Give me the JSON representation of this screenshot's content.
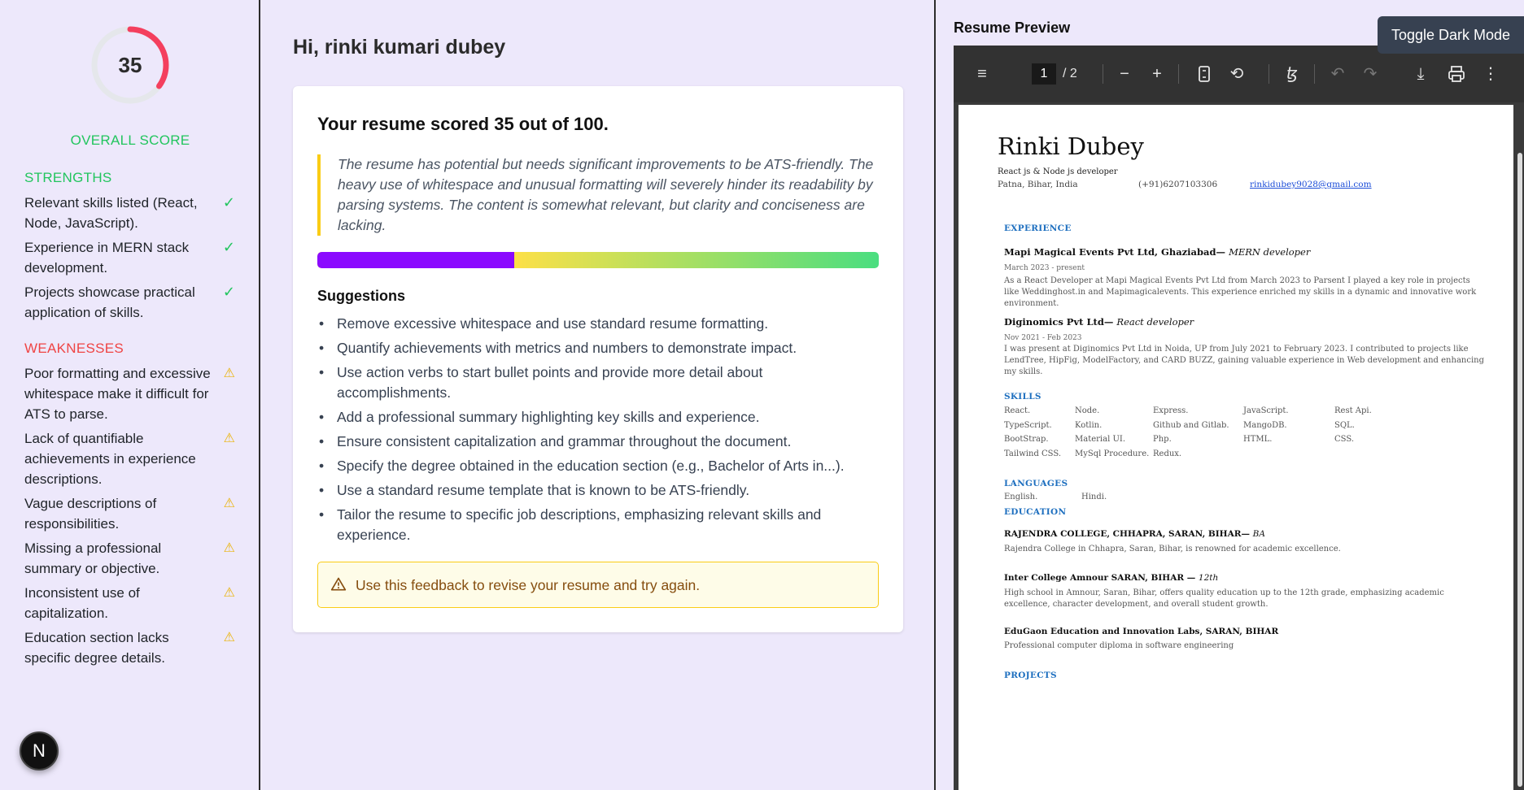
{
  "sidebar": {
    "score": "35",
    "score_fraction": 0.35,
    "overall_label": "OVERALL SCORE",
    "strengths_title": "STRENGTHS",
    "strengths": [
      "Relevant skills listed (React, Node, JavaScript).",
      "Experience in MERN stack development.",
      "Projects showcase practical application of skills."
    ],
    "weaknesses_title": "WEAKNESSES",
    "weaknesses": [
      "Poor formatting and excessive whitespace make it difficult for ATS to parse.",
      "Lack of quantifiable achievements in experience descriptions.",
      "Vague descriptions of responsibilities.",
      "Missing a professional summary or objective.",
      "Inconsistent use of capitalization.",
      "Education section lacks specific degree details."
    ],
    "check_glyph": "✓",
    "warn_glyph": "⚠",
    "fab_label": "N"
  },
  "main": {
    "greeting": "Hi, rinki kumari dubey",
    "headline": "Your resume scored 35 out of 100.",
    "summary": "The resume has potential but needs significant improvements to be ATS-friendly. The heavy use of whitespace and unusual formatting will severely hinder its readability by parsing systems. The content is somewhat relevant, but clarity and conciseness are lacking.",
    "score_bar_fraction": 0.35,
    "suggestions_title": "Suggestions",
    "suggestions": [
      "Remove excessive whitespace and use standard resume formatting.",
      "Quantify achievements with metrics and numbers to demonstrate impact.",
      "Use action verbs to start bullet points and provide more detail about accomplishments.",
      "Add a professional summary highlighting key skills and experience.",
      "Ensure consistent capitalization and grammar throughout the document.",
      "Specify the degree obtained in the education section (e.g., Bachelor of Arts in...).",
      "Use a standard resume template that is known to be ATS-friendly.",
      "Tailor the resume to specific job descriptions, emphasizing relevant skills and experience."
    ],
    "alert": "Use this feedback to revise your resume and try again."
  },
  "preview": {
    "title": "Resume Preview",
    "toggle_label": "Toggle Dark Mode",
    "toolbar": {
      "page_current": "1",
      "page_total": "/ 2",
      "icons": [
        "menu-icon",
        "zoom-out-icon",
        "zoom-in-icon",
        "fit-page-icon",
        "rotate-icon",
        "annotate-icon",
        "undo-icon",
        "redo-icon",
        "download-icon",
        "print-icon",
        "more-icon"
      ]
    },
    "resume": {
      "name": "Rinki Dubey",
      "subtitle": "React js & Node js developer",
      "location": "Patna, Bihar, India",
      "phone": "(+91)6207103306",
      "email": "rinkidubey9028@gmail.com",
      "experience_title": "EXPERIENCE",
      "job1_company": "Mapi Magical Events Pvt Ltd, Ghaziabad—",
      "job1_role": "MERN developer",
      "job1_date": "March 2023 - present",
      "job1_desc": "As a React Developer at Mapi Magical Events Pvt Ltd from March 2023 to Parsent I played a key role in projects like Weddinghost.in and Mapimagicalevents. This experience enriched my skills in a dynamic and innovative work environment.",
      "job2_company": "Diginomics Pvt Ltd—",
      "job2_role": "React developer",
      "job2_date": "Nov 2021 - Feb 2023",
      "job2_desc": "I was present at Diginomics Pvt Ltd in Noida, UP from July 2021 to February 2023. I contributed to projects like LendTree, HipFig, ModelFactory, and CARD BUZZ, gaining valuable experience in Web development and enhancing my skills.",
      "skills_title": "SKILLS",
      "skills": [
        [
          "React.",
          "Node.",
          "Express.",
          "JavaScript.",
          "Rest Api."
        ],
        [
          "TypeScript.",
          "Kotlin.",
          "Github and Gitlab.",
          "MangoDB.",
          "SQL."
        ],
        [
          "BootStrap.",
          "Material UI.",
          "Php.",
          "HTML.",
          "CSS."
        ],
        [
          "Tailwind CSS.",
          "MySql Procedure.",
          "Redux.",
          "",
          ""
        ]
      ],
      "languages_title": "LANGUAGES",
      "languages": [
        "English.",
        "Hindi."
      ],
      "education_title": "EDUCATION",
      "edu1_school": "RAJENDRA COLLEGE, CHHAPRA, SARAN, BIHAR—",
      "edu1_degree": "BA",
      "edu1_desc": "Rajendra College in Chhapra, Saran, Bihar, is renowned for academic excellence.",
      "edu2_school": "Inter College Amnour SARAN, BIHAR —",
      "edu2_degree": "12th",
      "edu2_desc": "High school in Amnour, Saran, Bihar, offers quality education up to the 12th grade, emphasizing academic excellence, character development, and overall student growth.",
      "edu3_school": "EduGaon Education and Innovation Labs, SARAN, BIHAR",
      "edu3_desc": "Professional computer diploma in software engineering",
      "projects_title": "PROJECTS"
    }
  },
  "colors": {
    "background": "#ede8fb",
    "strength_green": "#22c55e",
    "weakness_red": "#ef4444",
    "ring_red": "#f43f5e",
    "warning_yellow": "#eab308",
    "bar_purple": "#8b0aff"
  }
}
